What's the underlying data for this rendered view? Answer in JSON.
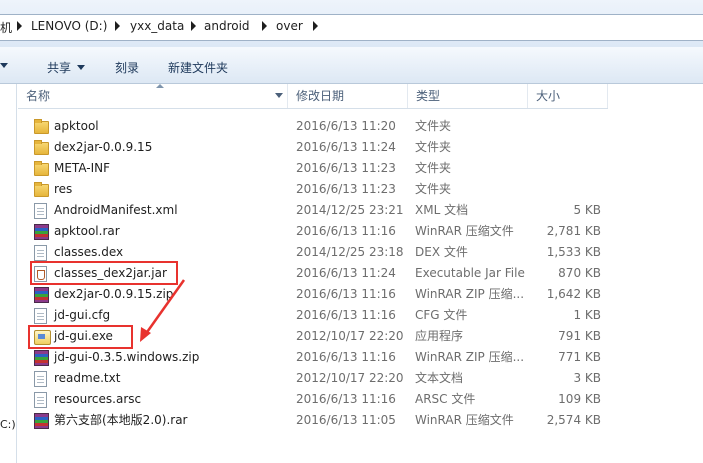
{
  "address_bar": {
    "prefix": "机",
    "crumbs": [
      "LENOVO (D:)",
      "yxx_data",
      "android",
      "over"
    ]
  },
  "toolbar": {
    "share_label": "共享",
    "burn_label": "刻录",
    "new_folder_label": "新建文件夹"
  },
  "columns": {
    "name": "名称",
    "date": "修改日期",
    "type": "类型",
    "size": "大小"
  },
  "nav_fragment": "C:)",
  "files": [
    {
      "name": "apktool",
      "date": "2016/6/13 11:20",
      "type": "文件夹",
      "size": "",
      "icon": "folder-icon"
    },
    {
      "name": "dex2jar-0.0.9.15",
      "date": "2016/6/13 11:24",
      "type": "文件夹",
      "size": "",
      "icon": "folder-icon"
    },
    {
      "name": "META-INF",
      "date": "2016/6/13 11:23",
      "type": "文件夹",
      "size": "",
      "icon": "folder-icon"
    },
    {
      "name": "res",
      "date": "2016/6/13 11:23",
      "type": "文件夹",
      "size": "",
      "icon": "folder-icon"
    },
    {
      "name": "AndroidManifest.xml",
      "date": "2014/12/25 23:21",
      "type": "XML 文档",
      "size": "5 KB",
      "icon": "xml-file-icon"
    },
    {
      "name": "apktool.rar",
      "date": "2016/6/13 11:16",
      "type": "WinRAR 压缩文件",
      "size": "2,781 KB",
      "icon": "rar-archive-icon"
    },
    {
      "name": "classes.dex",
      "date": "2014/12/25 23:18",
      "type": "DEX 文件",
      "size": "1,533 KB",
      "icon": "file-icon"
    },
    {
      "name": "classes_dex2jar.jar",
      "date": "2016/6/13 11:24",
      "type": "Executable Jar File",
      "size": "870 KB",
      "icon": "jar-file-icon"
    },
    {
      "name": "dex2jar-0.0.9.15.zip",
      "date": "2016/6/13 11:16",
      "type": "WinRAR ZIP 压缩...",
      "size": "1,642 KB",
      "icon": "rar-archive-icon"
    },
    {
      "name": "jd-gui.cfg",
      "date": "2016/6/13 11:16",
      "type": "CFG 文件",
      "size": "1 KB",
      "icon": "file-icon"
    },
    {
      "name": "jd-gui.exe",
      "date": "2012/10/17 22:20",
      "type": "应用程序",
      "size": "791 KB",
      "icon": "exe-icon"
    },
    {
      "name": "jd-gui-0.3.5.windows.zip",
      "date": "2016/6/13 11:16",
      "type": "WinRAR ZIP 压缩...",
      "size": "771 KB",
      "icon": "rar-archive-icon"
    },
    {
      "name": "readme.txt",
      "date": "2012/10/17 22:20",
      "type": "文本文档",
      "size": "3 KB",
      "icon": "text-file-icon"
    },
    {
      "name": "resources.arsc",
      "date": "2016/6/13 11:16",
      "type": "ARSC 文件",
      "size": "109 KB",
      "icon": "file-icon"
    },
    {
      "name": "第六支部(本地版2.0).rar",
      "date": "2016/6/13 11:05",
      "type": "WinRAR 压缩文件",
      "size": "2,574 KB",
      "icon": "rar-archive-icon"
    }
  ],
  "highlight_color": "#e8322e"
}
